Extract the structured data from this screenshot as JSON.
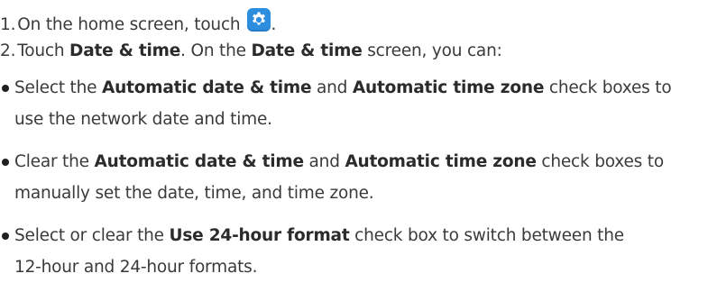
{
  "steps": [
    {
      "num": "1.",
      "text_before": "On the home screen, touch",
      "icon": "settings-gear-icon",
      "text_after": "."
    },
    {
      "num": "2.",
      "t1": "Touch ",
      "b1": "Date & time",
      "t2": ". On the ",
      "b2": "Date & time",
      "t3": " screen, you can:"
    }
  ],
  "bullets": [
    {
      "t1": "Select the ",
      "b1": "Automatic date & time",
      "t2": " and ",
      "b2": "Automatic time zone",
      "t3": " check boxes to",
      "cont": "use the network date and time."
    },
    {
      "t1": "Clear the ",
      "b1": "Automatic date & time",
      "t2": " and ",
      "b2": "Automatic time zone",
      "t3": " check boxes to",
      "cont": "manually set the date, time, and time zone."
    },
    {
      "t1": "Select or clear the ",
      "b1": "Use 24-hour format",
      "t2": " check box to switch between the",
      "cont": "12-hour and 24-hour formats."
    }
  ],
  "colors": {
    "icon_bg": "#2d8ee0",
    "text": "#3a3a3a"
  }
}
